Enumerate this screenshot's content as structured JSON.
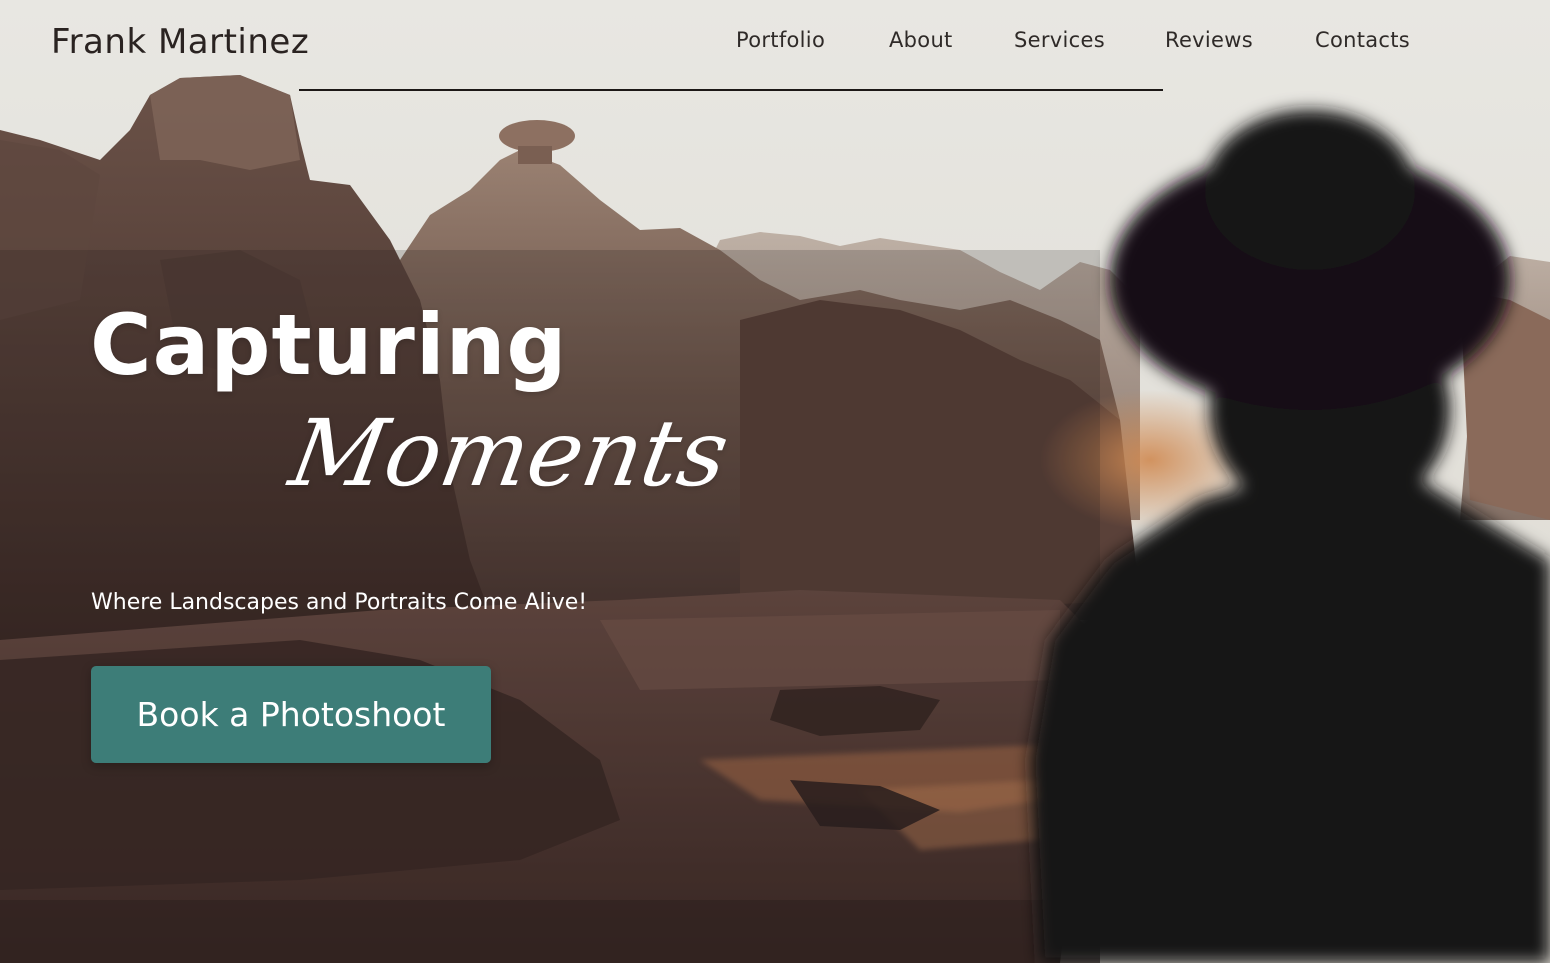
{
  "header": {
    "brand": "Frank Martinez",
    "nav": [
      {
        "label": "Portfolio"
      },
      {
        "label": "About"
      },
      {
        "label": "Services"
      },
      {
        "label": "Reviews"
      },
      {
        "label": "Contacts"
      }
    ]
  },
  "hero": {
    "title": "Capturing",
    "script_title": "Moments",
    "subtitle": "Where Landscapes and Portraits Come Alive!",
    "cta_label": "Book a Photoshoot"
  },
  "colors": {
    "accent": "#3d7d78",
    "sky": "#e7e6e1",
    "text_dark": "#2a2321"
  }
}
